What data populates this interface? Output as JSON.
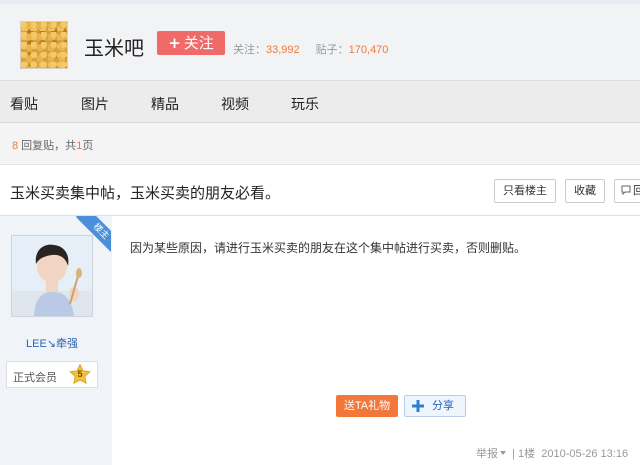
{
  "header": {
    "forum_name": "玉米吧",
    "follow_label": "关注",
    "follow_plus": "+",
    "followers_label": "关注：",
    "followers_count": "33,992",
    "posts_label": "贴子：",
    "posts_count": "170,470"
  },
  "nav": {
    "items": [
      {
        "label": "看贴"
      },
      {
        "label": "图片"
      },
      {
        "label": "精品"
      },
      {
        "label": "视频"
      },
      {
        "label": "玩乐"
      }
    ]
  },
  "page_info": {
    "reply_count": "8",
    "reply_text": " 回复贴，共",
    "page_count": "1",
    "page_text": "页"
  },
  "thread": {
    "title": "玉米买卖集中帖，玉米买卖的朋友必看。",
    "only_owner_label": "只看楼主",
    "favorite_label": "收藏",
    "reply_label": "回"
  },
  "post": {
    "owner_badge": "楼主",
    "author_name": "LEE↘牵强",
    "member_label": "正式会员",
    "level": "5",
    "content": "因为某些原因，请进行玉米买卖的朋友在这个集中帖进行买卖，否则删贴。",
    "gift_label": "送TA礼物",
    "share_label": "分享",
    "report_label": "举报",
    "floor": "1楼",
    "timestamp": "2010-05-26 13:16"
  },
  "colors": {
    "accent_orange": "#f07a3c",
    "follow_red": "#f06a6a",
    "link_blue": "#2d64b3",
    "badge_blue": "#4a8fd9"
  }
}
